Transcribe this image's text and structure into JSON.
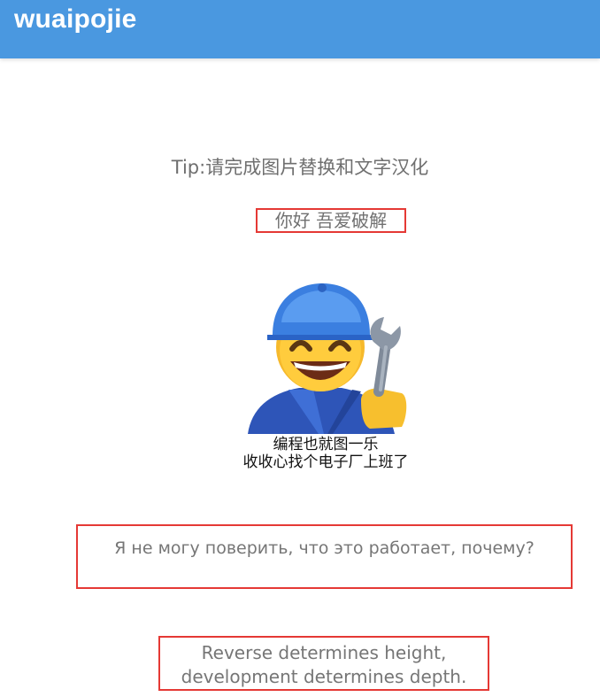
{
  "app": {
    "title": "wuaipojie"
  },
  "content": {
    "tip": "Tip:请完成图片替换和文字汉化",
    "hello": "你好 吾爱破解",
    "meme_caption": "编程也就图一乐\n收收心找个电子厂上班了",
    "russian_text": "Я не могу поверить, что это работает, почему?",
    "english_text": "Reverse determines height,\ndevelopment determines depth."
  },
  "icons": {
    "meme": "worker-emoji-with-wrench-icon"
  },
  "colors": {
    "topbar": "#4a98e0",
    "highlight_box": "#e53935",
    "text_gray": "#767676"
  }
}
